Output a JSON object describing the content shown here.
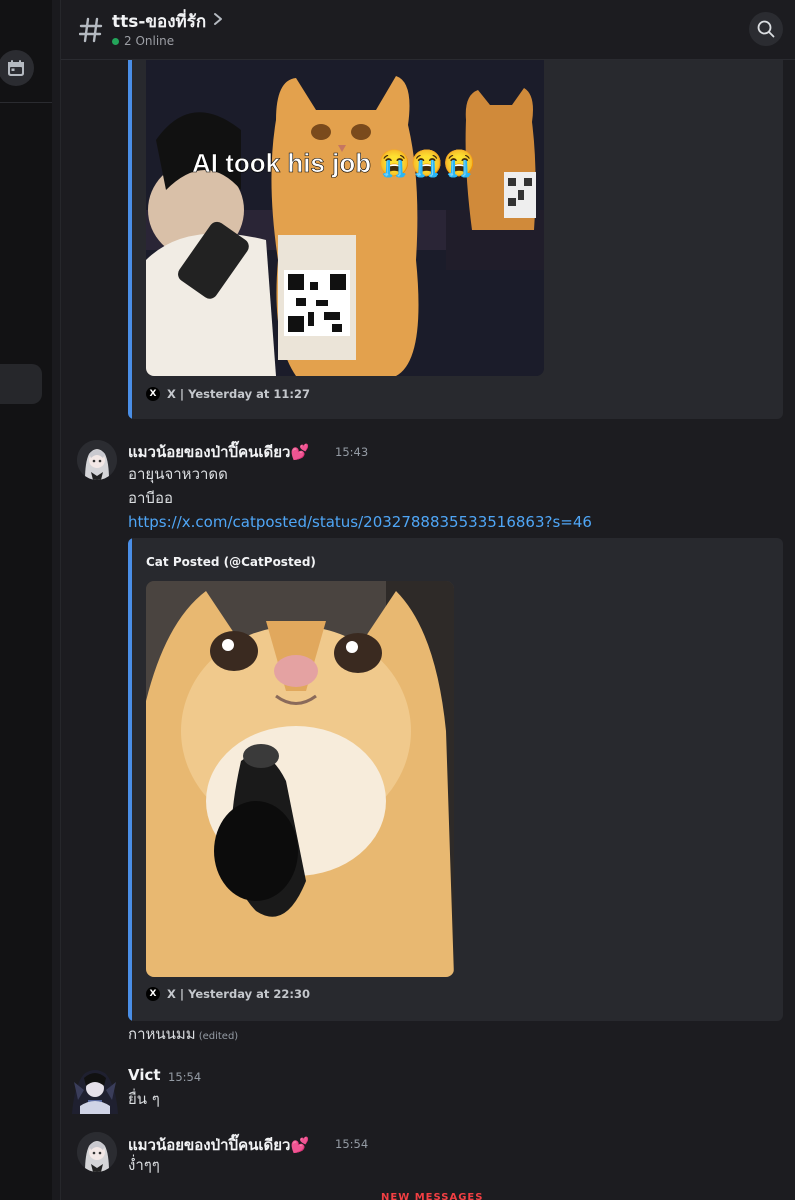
{
  "channel": {
    "name": "tts-ของที่รัก",
    "online": "2 Online"
  },
  "embeds": [
    {
      "footer": "X | Yesterday at 11:27",
      "image_caption": "AI took his job 😭😭😭"
    },
    {
      "author": "Cat Posted (@CatPosted)",
      "footer": "X | Yesterday at 22:30"
    }
  ],
  "messages": [
    {
      "author": "แมวน้อยของป่าปิ๊คนเดียว💕",
      "time": "15:43",
      "lines": [
        "อายุนจาหวาดด",
        "อาบีออ"
      ],
      "link": "https://x.com/catposted/status/2032788835533516863?s=46",
      "after_embed": "กาหนนมม",
      "edited_label": "(edited)"
    },
    {
      "author": "Vict",
      "time": "15:54",
      "lines": [
        "ยื่น ๆ"
      ]
    },
    {
      "author": "แมวน้อยของป่าปิ๊คนเดียว💕",
      "time": "15:54",
      "lines": [
        "ง่ำๆๆ"
      ]
    }
  ],
  "new_messages_label": "NEW MESSAGES",
  "colors": {
    "accent_blue": "#4a8ee6",
    "link": "#4fa6f6",
    "online": "#23a55a",
    "new_messages": "#f23f43"
  },
  "icons": [
    "hash-icon",
    "chevron-right-icon",
    "search-icon",
    "calendar-icon",
    "x-logo-icon"
  ]
}
